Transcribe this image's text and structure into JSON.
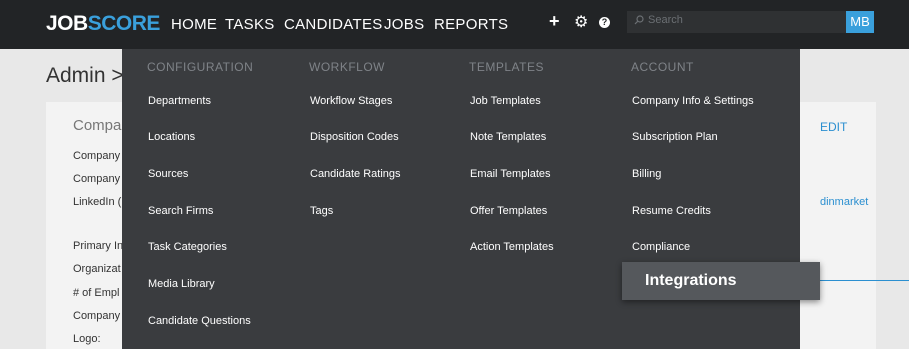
{
  "header": {
    "logo_part1": "JOB",
    "logo_part2": "SCORE",
    "nav": [
      "HOME",
      "TASKS",
      "CANDIDATES",
      "JOBS",
      "REPORTS"
    ],
    "search_placeholder": "Search",
    "avatar_initials": "MB"
  },
  "page": {
    "title": "Admin >",
    "card_title": "Compar",
    "fields": [
      "Company",
      "Company",
      "LinkedIn (",
      "Primary In",
      "Organizat",
      "# of Empl",
      "Company",
      "Logo:"
    ],
    "edit_label": "EDIT",
    "linkedin_value": "dinmarket"
  },
  "menu": {
    "columns": [
      {
        "header": "CONFIGURATION",
        "items": [
          "Departments",
          "Locations",
          "Sources",
          "Search Firms",
          "Task Categories",
          "Media Library",
          "Candidate Questions"
        ]
      },
      {
        "header": "WORKFLOW",
        "items": [
          "Workflow Stages",
          "Disposition Codes",
          "Candidate Ratings",
          "Tags"
        ]
      },
      {
        "header": "TEMPLATES",
        "items": [
          "Job Templates",
          "Note Templates",
          "Email Templates",
          "Offer Templates",
          "Action Templates"
        ]
      },
      {
        "header": "ACCOUNT",
        "items": [
          "Company Info & Settings",
          "Subscription Plan",
          "Billing",
          "Resume Credits",
          "Compliance"
        ]
      }
    ],
    "highlighted": "Integrations"
  },
  "colors": {
    "topbar": "#222426",
    "menu_bg": "#3a3c3f",
    "accent": "#3aa0dc",
    "highlight": "#55585c"
  }
}
